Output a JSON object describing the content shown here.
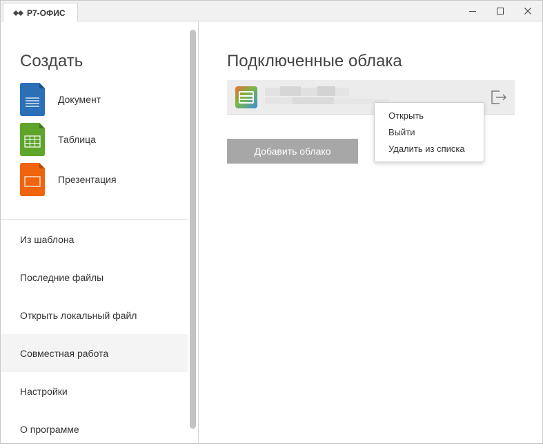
{
  "titlebar": {
    "app_name": "Р7-ОФИС",
    "minimize_symbol": "—",
    "maximize_symbol": "☐",
    "close_symbol": "✕"
  },
  "sidebar": {
    "create_title": "Создать",
    "create_items": [
      {
        "label": "Документ",
        "icon": "document-icon",
        "color": "#2b6fb7"
      },
      {
        "label": "Таблица",
        "icon": "spreadsheet-icon",
        "color": "#5fa52b"
      },
      {
        "label": "Презентация",
        "icon": "presentation-icon",
        "color": "#f0640f"
      }
    ],
    "nav_items": [
      {
        "label": "Из шаблона"
      },
      {
        "label": "Последние файлы"
      },
      {
        "label": "Открыть локальный файл"
      },
      {
        "label": "Совместная работа",
        "active": true
      },
      {
        "label": "Настройки"
      },
      {
        "label": "О программе"
      }
    ]
  },
  "main": {
    "title": "Подключенные облака",
    "add_cloud_button": "Добавить облако",
    "cloud_icon": "cloud-provider-icon",
    "logout_icon": "logout-icon"
  },
  "context_menu": {
    "items": [
      "Открыть",
      "Выйти",
      "Удалить из списка"
    ]
  },
  "colors": {
    "accent_doc": "#2b6fb7",
    "accent_sheet": "#5fa52b",
    "accent_slide": "#f0640f",
    "button_bg": "#a7a7a7",
    "active_nav_bg": "#f4f4f4"
  }
}
